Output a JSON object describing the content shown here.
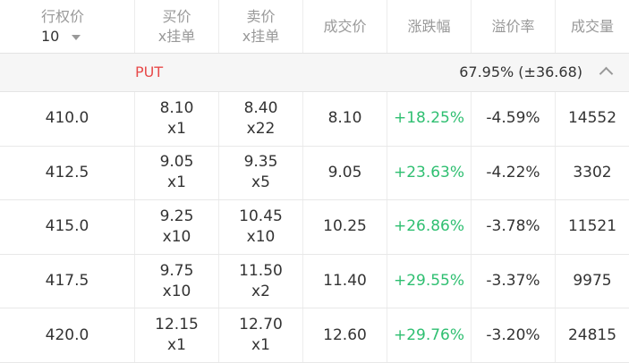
{
  "header": {
    "strike": "行权价",
    "strike_count": "10",
    "bid_line1": "买价",
    "bid_line2": "x挂单",
    "ask_line1": "卖价",
    "ask_line2": "x挂单",
    "last": "成交价",
    "change": "涨跌幅",
    "premium": "溢价率",
    "volume": "成交量"
  },
  "section": {
    "label": "PUT",
    "iv": "67.95% (±36.68)"
  },
  "colors": {
    "put_label": "#e84a4a",
    "up": "#2fbf71",
    "header_text": "#999999"
  },
  "rows": [
    {
      "strike": "410.0",
      "bid": "8.10",
      "bid_size": "x1",
      "ask": "8.40",
      "ask_size": "x22",
      "last": "8.10",
      "change": "+18.25%",
      "premium": "-4.59%",
      "volume": "14552"
    },
    {
      "strike": "412.5",
      "bid": "9.05",
      "bid_size": "x1",
      "ask": "9.35",
      "ask_size": "x5",
      "last": "9.05",
      "change": "+23.63%",
      "premium": "-4.22%",
      "volume": "3302"
    },
    {
      "strike": "415.0",
      "bid": "9.25",
      "bid_size": "x10",
      "ask": "10.45",
      "ask_size": "x10",
      "last": "10.25",
      "change": "+26.86%",
      "premium": "-3.78%",
      "volume": "11521"
    },
    {
      "strike": "417.5",
      "bid": "9.75",
      "bid_size": "x10",
      "ask": "11.50",
      "ask_size": "x2",
      "last": "11.40",
      "change": "+29.55%",
      "premium": "-3.37%",
      "volume": "9975"
    },
    {
      "strike": "420.0",
      "bid": "12.15",
      "bid_size": "x1",
      "ask": "12.70",
      "ask_size": "x1",
      "last": "12.60",
      "change": "+29.76%",
      "premium": "-3.20%",
      "volume": "24815"
    }
  ]
}
